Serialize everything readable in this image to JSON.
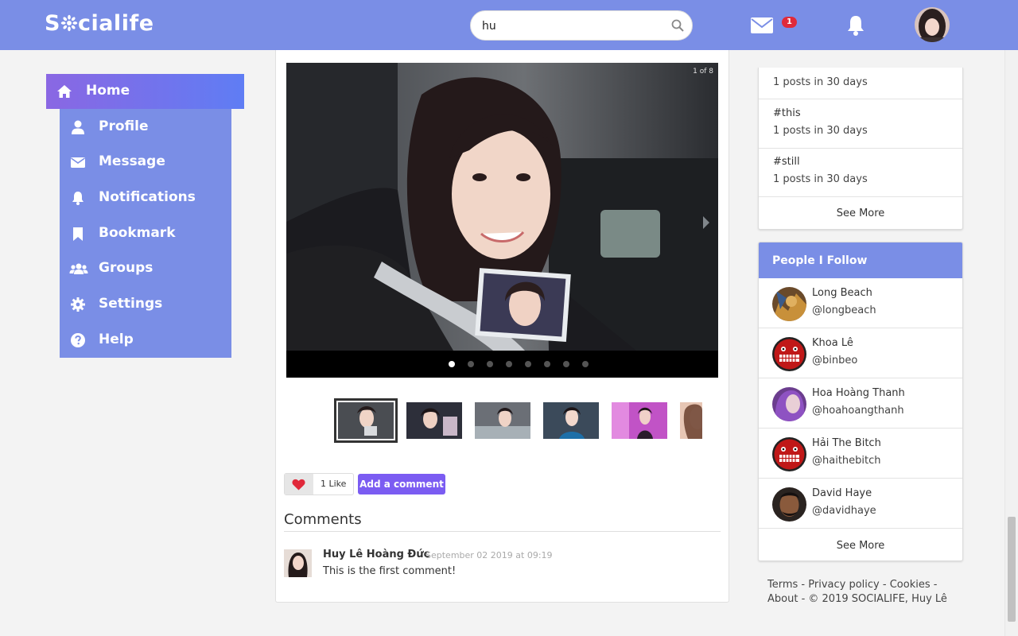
{
  "header": {
    "logo": "Socialife",
    "search_value": "hu",
    "messages_badge": "1"
  },
  "nav": {
    "items": [
      {
        "label": "Home",
        "icon": "home-icon"
      },
      {
        "label": "Profile",
        "icon": "user-icon"
      },
      {
        "label": "Message",
        "icon": "envelope-icon"
      },
      {
        "label": "Notifications",
        "icon": "bell-icon"
      },
      {
        "label": "Bookmark",
        "icon": "bookmark-icon"
      },
      {
        "label": "Groups",
        "icon": "users-icon"
      },
      {
        "label": "Settings",
        "icon": "gear-icon"
      },
      {
        "label": "Help",
        "icon": "question-circle-icon"
      }
    ]
  },
  "post": {
    "slide_counter": "1 of 8",
    "like_count": "1 Like",
    "add_comment": "Add a comment",
    "comments_title": "Comments",
    "comments": [
      {
        "author": "Huy Lê Hoàng Đức",
        "time": "September 02 2019 at 09:19",
        "text": "This is the first comment!"
      }
    ]
  },
  "trending": {
    "tags": [
      {
        "name": "",
        "count": "1 posts in 30 days"
      },
      {
        "name": "#this",
        "count": "1 posts in 30 days"
      },
      {
        "name": "#still",
        "count": "1 posts in 30 days"
      }
    ],
    "see_more": "See More"
  },
  "follow": {
    "title": "People I Follow",
    "people": [
      {
        "name": "Long Beach",
        "handle": "@longbeach"
      },
      {
        "name": "Khoa Lê",
        "handle": "@binbeo"
      },
      {
        "name": "Hoa Hoàng Thanh",
        "handle": "@hoahoangthanh"
      },
      {
        "name": "Hải The Bitch",
        "handle": "@haithebitch"
      },
      {
        "name": "David Haye",
        "handle": "@davidhaye"
      }
    ],
    "see_more": "See More"
  },
  "footer": {
    "terms": "Terms",
    "privacy": "Privacy policy",
    "cookies": "Cookies",
    "about": "About",
    "copyright": "© 2019 SOCIALIFE, Huy Lê"
  },
  "colors": {
    "primary": "#7a8ee6",
    "button": "#7b5cf2",
    "badge": "#e02a3a"
  }
}
